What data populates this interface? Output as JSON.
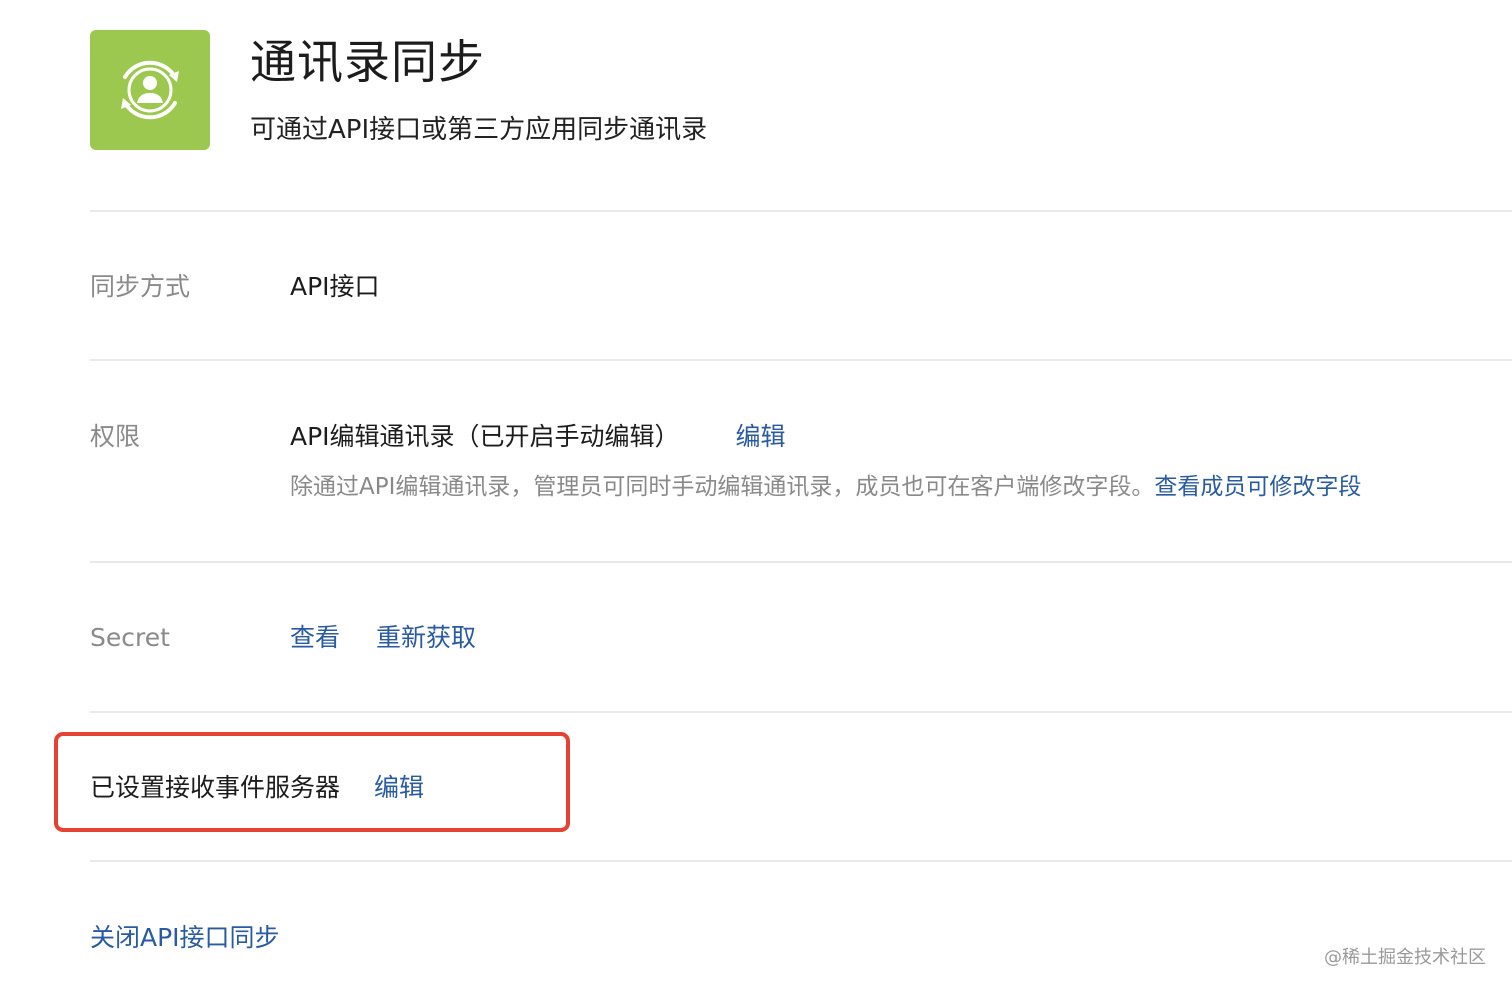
{
  "header": {
    "icon": "contact-sync-icon",
    "icon_color": "#9dc84f",
    "title": "通讯录同步",
    "description": "可通过API接口或第三方应用同步通讯录"
  },
  "sync_method": {
    "label": "同步方式",
    "value": "API接口"
  },
  "permission": {
    "label": "权限",
    "value": "API编辑通讯录（已开启手动编辑）",
    "edit_link": "编辑",
    "note": "除通过API编辑通讯录，管理员可同时手动编辑通讯录，成员也可在客户端修改字段。",
    "note_link": "查看成员可修改字段"
  },
  "secret": {
    "label": "Secret",
    "view_link": "查看",
    "refresh_link": "重新获取"
  },
  "event_server": {
    "label": "已设置接收事件服务器",
    "edit_link": "编辑",
    "highlight_color": "#e64234"
  },
  "footer": {
    "close_link": "关闭API接口同步"
  },
  "colors": {
    "link": "#2a5aa0",
    "label": "#8a8a8a",
    "divider": "#e9e9e9"
  },
  "watermark": "@稀土掘金技术社区"
}
